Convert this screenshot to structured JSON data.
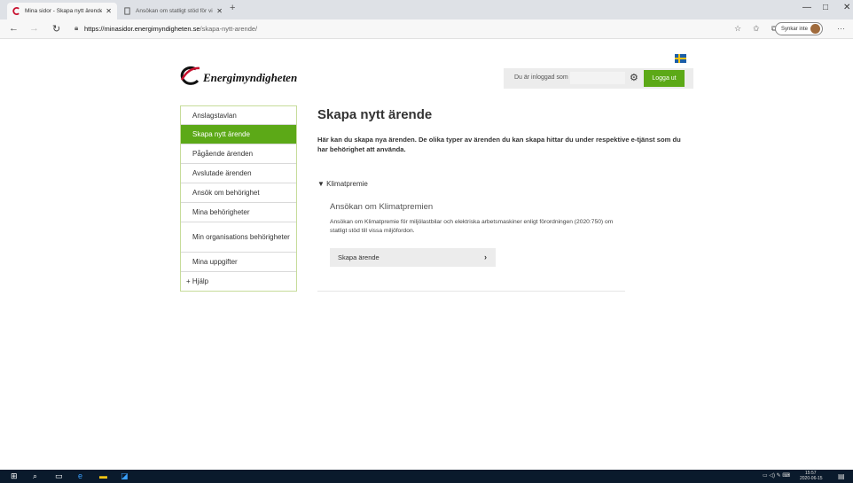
{
  "browser": {
    "tabs": [
      {
        "title": "Mina sidor - Skapa nytt ärende",
        "close": "✕"
      },
      {
        "title": "Ansökan om statligt stöd för viss",
        "close": "✕"
      }
    ],
    "new_tab": "+",
    "window_controls": {
      "minimize": "—",
      "maximize": "□",
      "close": "✕"
    },
    "url_domain": "https://minasidor.energimyndigheten.se",
    "url_path": "/skapa-nytt-arende/",
    "sync_label": "Synkar inte",
    "more": "···"
  },
  "header": {
    "logo_text": "Energimyndigheten",
    "logged_in_label": "Du är inloggad som",
    "logged_in_user": "",
    "logout_label": "Logga ut"
  },
  "sidebar": {
    "items": [
      {
        "label": "Anslagstavlan",
        "active": false
      },
      {
        "label": "Skapa nytt ärende",
        "active": true
      },
      {
        "label": "Pågående ärenden",
        "active": false
      },
      {
        "label": "Avslutade ärenden",
        "active": false
      },
      {
        "label": "Ansök om behörighet",
        "active": false
      },
      {
        "label": "Mina behörigheter",
        "active": false
      },
      {
        "label": "Min organisations behörigheter",
        "active": false
      },
      {
        "label": "Mina uppgifter",
        "active": false
      },
      {
        "label": "+ Hjälp",
        "active": false
      }
    ]
  },
  "main": {
    "title": "Skapa nytt ärende",
    "intro": "Här kan du skapa nya ärenden. De olika typer av ärenden du kan skapa hittar du under respektive e-tjänst som du har behörighet att använda.",
    "section_label": "Klimatpremie",
    "card_title": "Ansökan om Klimatpremien",
    "card_description": "Ansökan om Klimatpremie för miljölastbilar och elektriska arbetsmaskiner enligt förordningen (2020:750) om statligt stöd till vissa miljöfordon.",
    "create_button": "Skapa ärende"
  },
  "taskbar": {
    "time": "15:57",
    "date": "2020-06-15"
  },
  "colors": {
    "brand_green": "#5ca917",
    "sidebar_border": "#c6dc9a",
    "taskbar": "#0a1a2c"
  }
}
